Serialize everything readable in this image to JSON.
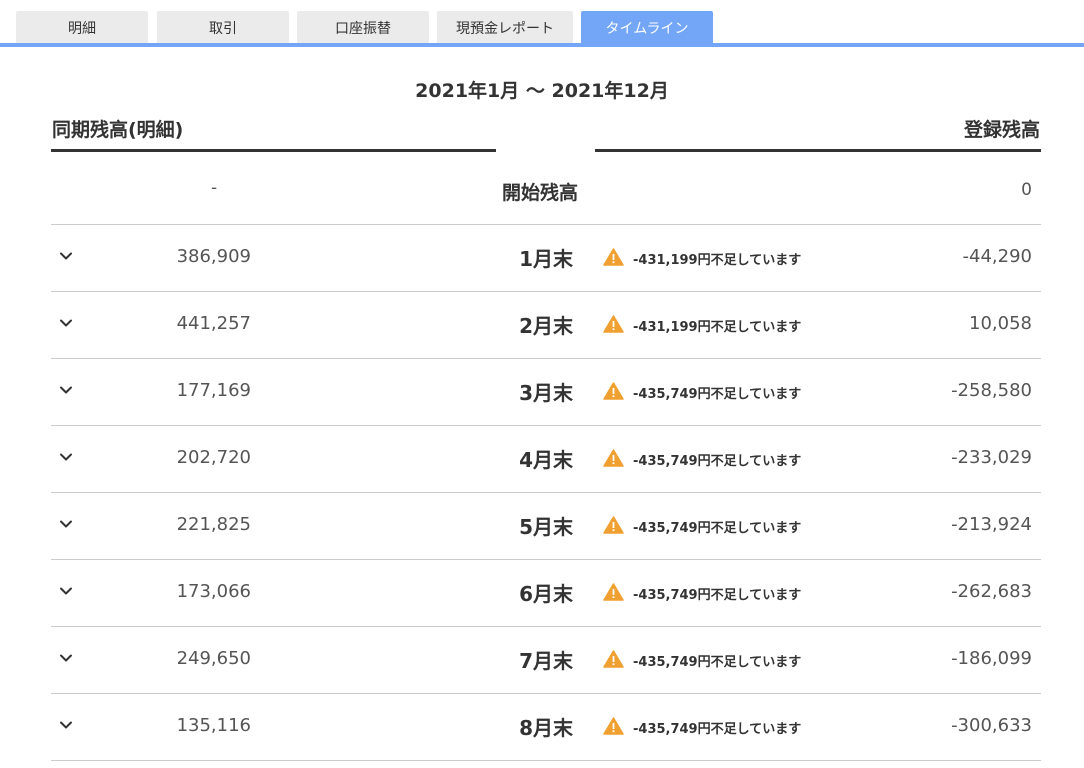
{
  "tabs": [
    {
      "label": "明細"
    },
    {
      "label": "取引"
    },
    {
      "label": "口座振替"
    },
    {
      "label": "現預金レポート"
    },
    {
      "label": "タイムライン",
      "active": true
    }
  ],
  "period": "2021年1月 〜 2021年12月",
  "headers": {
    "left": "同期残高(明細)",
    "right": "登録残高"
  },
  "start": {
    "left": "-",
    "label": "開始残高",
    "right": "0"
  },
  "rows": [
    {
      "ledger": "386,909",
      "month": "1月末",
      "warning": "-431,199円不足しています",
      "registered": "-44,290"
    },
    {
      "ledger": "441,257",
      "month": "2月末",
      "warning": "-431,199円不足しています",
      "registered": "10,058"
    },
    {
      "ledger": "177,169",
      "month": "3月末",
      "warning": "-435,749円不足しています",
      "registered": "-258,580"
    },
    {
      "ledger": "202,720",
      "month": "4月末",
      "warning": "-435,749円不足しています",
      "registered": "-233,029"
    },
    {
      "ledger": "221,825",
      "month": "5月末",
      "warning": "-435,749円不足しています",
      "registered": "-213,924"
    },
    {
      "ledger": "173,066",
      "month": "6月末",
      "warning": "-435,749円不足しています",
      "registered": "-262,683"
    },
    {
      "ledger": "249,650",
      "month": "7月末",
      "warning": "-435,749円不足しています",
      "registered": "-186,099"
    },
    {
      "ledger": "135,116",
      "month": "8月末",
      "warning": "-435,749円不足しています",
      "registered": "-300,633"
    }
  ],
  "colors": {
    "accent": "#74a6f7",
    "tab_bg": "#ebebeb",
    "warning": "#f0a030"
  },
  "icons": {
    "expand": "chevron-down-icon",
    "warning": "warning-icon"
  }
}
